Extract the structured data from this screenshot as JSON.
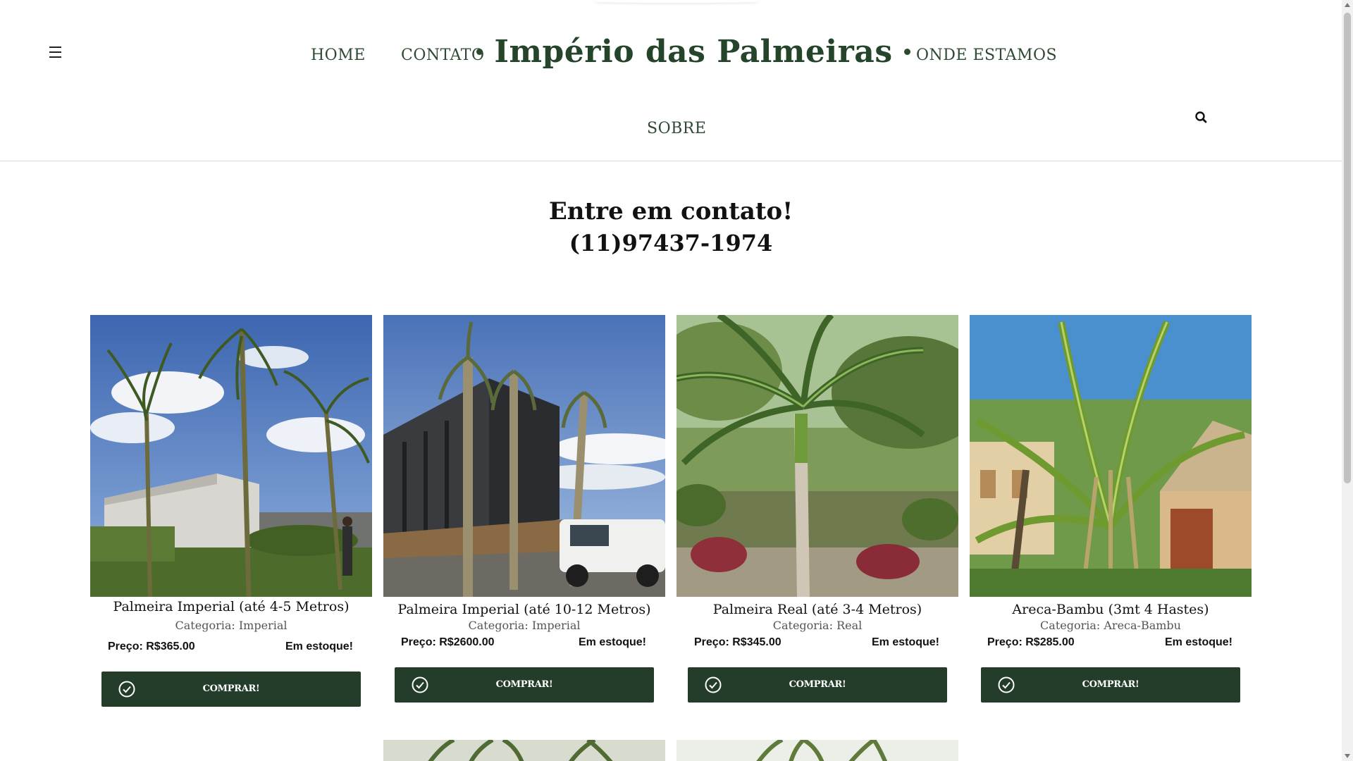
{
  "header": {
    "menu_icon": "hamburger-menu-icon",
    "nav": {
      "home": "HOME",
      "contato": "CONTATO",
      "onde_estamos": "ONDE ESTAMOS",
      "sobre": "SOBRE"
    },
    "brand": "Império das Palmeiras",
    "search_icon": "search-icon"
  },
  "contact": {
    "title": "Entre em contato!",
    "phone": "(11)97437-1974"
  },
  "products": [
    {
      "name": "Palmeira Imperial (até 4-5 Metros)",
      "category": "Categoria: Imperial",
      "price": "Preço: R$365.00",
      "stock": "Em estoque!",
      "button": "COMPRAR!"
    },
    {
      "name": "Palmeira Imperial (até 10-12 Metros)",
      "category": "Categoria: Imperial",
      "price": "Preço: R$2600.00",
      "stock": "Em estoque!",
      "button": "COMPRAR!"
    },
    {
      "name": "Palmeira Real (até 3-4 Metros)",
      "category": "Categoria: Real",
      "price": "Preço: R$345.00",
      "stock": "Em estoque!",
      "button": "COMPRAR!"
    },
    {
      "name": "Areca-Bambu (3mt 4 Hastes)",
      "category": "Categoria: Areca-Bambu",
      "price": "Preço: R$285.00",
      "stock": "Em estoque!",
      "button": "COMPRAR!"
    }
  ],
  "colors": {
    "brand_green": "#25452a",
    "button_green": "#233d2a",
    "nav_text": "#2e4a33"
  },
  "icons": {
    "button_icon": "check-circle-icon"
  }
}
